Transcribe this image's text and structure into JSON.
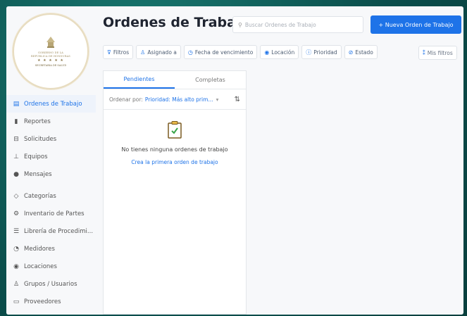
{
  "logo": {
    "line1": "GOBIERNO DE LA",
    "line2": "REPUBLICA DE HONDURAS",
    "stars": "★ ★ ★ ★ ★",
    "bottom": "SECRETARIA DE SALUD"
  },
  "sidebar": {
    "items": [
      {
        "label": "Ordenes de Trabajo",
        "icon": "work-order-icon",
        "glyph": "▤",
        "active": true
      },
      {
        "label": "Reportes",
        "icon": "bar-chart-icon",
        "glyph": "▮",
        "active": false
      },
      {
        "label": "Solicitudes",
        "icon": "inbox-icon",
        "glyph": "⊟",
        "active": false
      },
      {
        "label": "Equipos",
        "icon": "hierarchy-icon",
        "glyph": "⊥",
        "active": false
      },
      {
        "label": "Mensajes",
        "icon": "message-icon",
        "glyph": "●",
        "active": false
      },
      {
        "label": "Categorías",
        "icon": "tag-icon",
        "glyph": "◇",
        "active": false
      },
      {
        "label": "Inventario de Partes",
        "icon": "gear-icon",
        "glyph": "⚙",
        "active": false
      },
      {
        "label": "Librería de Procedimi...",
        "icon": "list-icon",
        "glyph": "☰",
        "active": false
      },
      {
        "label": "Medidores",
        "icon": "gauge-icon",
        "glyph": "◔",
        "active": false
      },
      {
        "label": "Locaciones",
        "icon": "location-icon",
        "glyph": "◉",
        "active": false
      },
      {
        "label": "Grupos / Usuarios",
        "icon": "users-icon",
        "glyph": "♙",
        "active": false
      },
      {
        "label": "Proveedores",
        "icon": "vendor-icon",
        "glyph": "▭",
        "active": false
      }
    ]
  },
  "header": {
    "title": "Ordenes de Trabajo",
    "search_placeholder": "Buscar Ordenes de Trabajo",
    "new_button": "+ Nueva Orden de Trabajo"
  },
  "filters": {
    "chips": [
      {
        "label": "Filtros",
        "glyph": "⊽"
      },
      {
        "label": "Asignado a",
        "glyph": "♙"
      },
      {
        "label": "Fecha de vencimiento",
        "glyph": "◷"
      },
      {
        "label": "Locación",
        "glyph": "◉"
      },
      {
        "label": "Prioridad",
        "glyph": "ⓘ"
      },
      {
        "label": "Estado",
        "glyph": "⊘"
      }
    ],
    "more": "Mis filtros",
    "more_glyph": "⁑"
  },
  "panel": {
    "tabs": {
      "pending": "Pendientes",
      "completed": "Completas"
    },
    "sort_label": "Ordenar por:",
    "sort_value": "Prioridad: Más alto prim...",
    "empty_text": "No tienes ninguna ordenes de trabajo",
    "empty_link": "Crea la primera orden de trabajo"
  },
  "colors": {
    "accent": "#1e73e8",
    "background": "#0e5f5b"
  }
}
